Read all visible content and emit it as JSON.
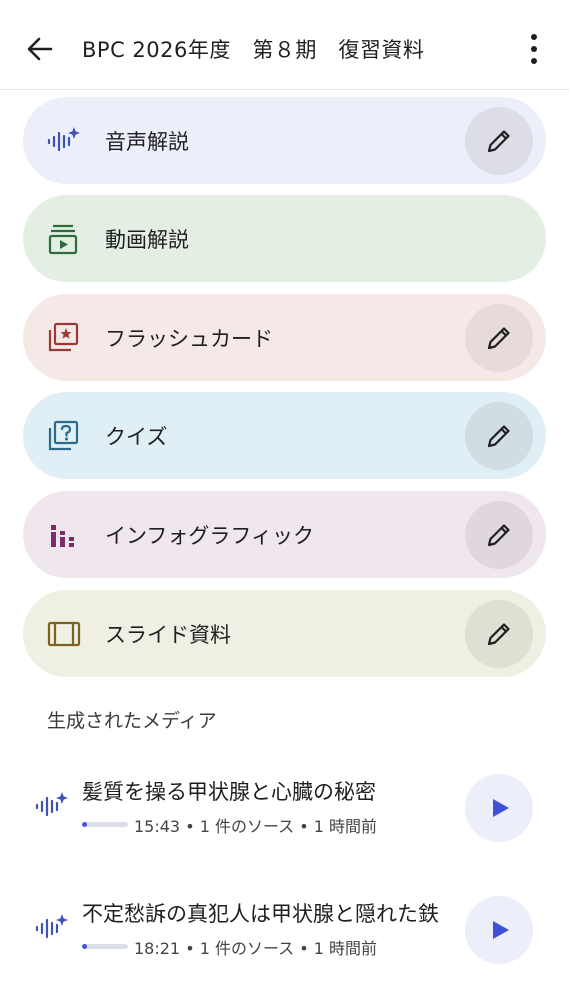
{
  "header": {
    "title": "BPC 2026年度　第８期　復習資料"
  },
  "cards": [
    {
      "label": "音声解説",
      "bg": "#eceef9",
      "edit_bg": "#dcdde6",
      "icon": "audio-sparkle-icon",
      "icon_color": "#3f51b5",
      "has_edit": true
    },
    {
      "label": "動画解説",
      "bg": "#e3efe3",
      "icon": "video-icon",
      "icon_color": "#2f6b3c",
      "has_edit": false
    },
    {
      "label": "フラッシュカード",
      "bg": "#f5e9e8",
      "edit_bg": "#e6dbda",
      "icon": "flashcard-icon",
      "icon_color": "#9a3a36",
      "has_edit": true
    },
    {
      "label": "クイズ",
      "bg": "#e0eff5",
      "edit_bg": "#d0dee4",
      "icon": "quiz-icon",
      "icon_color": "#2c6b8e",
      "has_edit": true
    },
    {
      "label": "インフォグラフィック",
      "bg": "#efe6ee",
      "edit_bg": "#dfd6de",
      "icon": "infographic-icon",
      "icon_color": "#7b2c6e",
      "has_edit": true
    },
    {
      "label": "スライド資料",
      "bg": "#f0efe3",
      "edit_bg": "#dfdfd4",
      "icon": "slides-icon",
      "icon_color": "#7a6320",
      "has_edit": true
    }
  ],
  "section_title": "生成されたメディア",
  "media": [
    {
      "title": "髪質を操る甲状腺と心臓の秘密",
      "meta": "15:43 • 1 件のソース • 1 時間前",
      "progress": 0.1
    },
    {
      "title": "不定愁訴の真犯人は甲状腺と隠れた鉄",
      "meta": "18:21 • 1 件のソース • 1 時間前",
      "progress": 0.1
    }
  ],
  "colors": {
    "accent": "#3f51b5",
    "play": "#3f51d9"
  }
}
